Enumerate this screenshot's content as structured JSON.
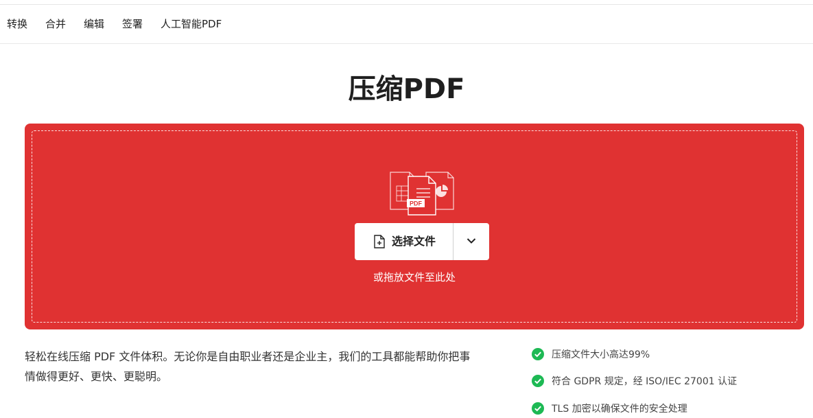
{
  "nav": {
    "items": [
      {
        "label": "转换"
      },
      {
        "label": "合并"
      },
      {
        "label": "编辑"
      },
      {
        "label": "签署"
      },
      {
        "label": "人工智能PDF"
      }
    ]
  },
  "page": {
    "title": "压缩PDF"
  },
  "upload": {
    "choose_label": "选择文件",
    "drop_hint": "或拖放文件至此处",
    "badge": "PDF",
    "color": "#e03232"
  },
  "description": "轻松在线压缩 PDF 文件体积。无论你是自由职业者还是企业主，我们的工具都能帮助你把事情做得更好、更快、更聪明。",
  "features": [
    {
      "text": "压缩文件大小高达99%",
      "icon": "check-circle-icon"
    },
    {
      "text": "符合 GDPR 规定，经 ISO/IEC 27001 认证",
      "icon": "check-circle-icon"
    },
    {
      "text": "TLS 加密以确保文件的安全处理",
      "icon": "check-circle-icon"
    }
  ],
  "colors": {
    "accent": "#e03232",
    "check": "#1db954"
  }
}
